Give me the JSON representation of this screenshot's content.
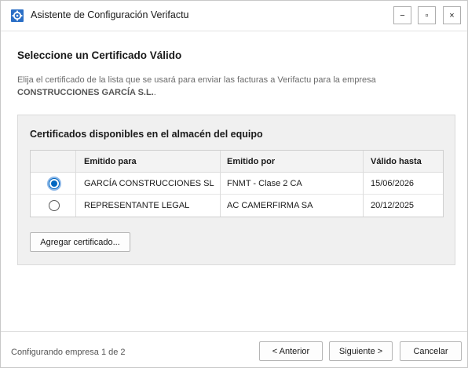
{
  "window": {
    "title": "Asistente de Configuración Verifactu",
    "icon": "gear-app-icon",
    "controls": {
      "minimize": "−",
      "maximize": "▫",
      "close": "×"
    }
  },
  "main": {
    "heading": "Seleccione un Certificado Válido",
    "description_prefix": "Elija el certificado de la lista que se usará para enviar las facturas a Verifactu para la empresa ",
    "company": "CONSTRUCCIONES GARCÍA S.L.",
    "description_suffix": "."
  },
  "certificates": {
    "group_title": "Certificados disponibles en el almacén del equipo",
    "columns": [
      "",
      "Emitido para",
      "Emitido por",
      "Válido hasta"
    ],
    "rows": [
      {
        "selected": true,
        "issued_to": "GARCÍA CONSTRUCCIONES SL",
        "issued_by": "FNMT - Clase 2 CA",
        "valid_until": "15/06/2026"
      },
      {
        "selected": false,
        "issued_to": "REPRESENTANTE LEGAL",
        "issued_by": "AC CAMERFIRMA SA",
        "valid_until": "20/12/2025"
      }
    ],
    "add_button": "Agregar certificado..."
  },
  "footer": {
    "status": "Configurando empresa 1 de 2",
    "prev": "< Anterior",
    "next": "Siguiente >",
    "cancel": "Cancelar"
  },
  "colors": {
    "accent": "#0067c0",
    "group_bg": "#f0f0f0"
  }
}
